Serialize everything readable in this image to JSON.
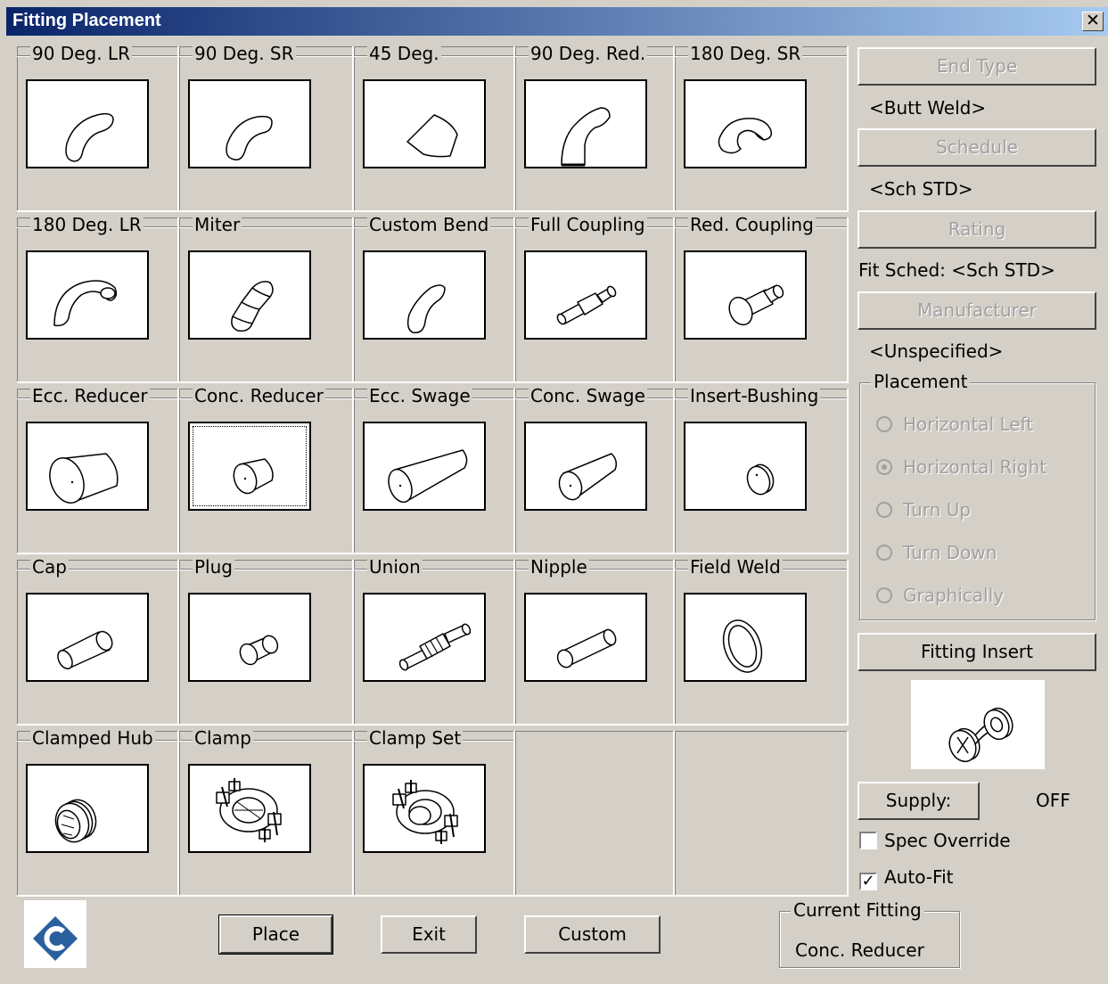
{
  "window": {
    "title": "Fitting Placement",
    "close_glyph": "✕"
  },
  "fittings": [
    {
      "label": "90 Deg. LR",
      "icon": "elbow-90-lr-icon"
    },
    {
      "label": "90 Deg. SR",
      "icon": "elbow-90-sr-icon"
    },
    {
      "label": "45 Deg.",
      "icon": "elbow-45-icon"
    },
    {
      "label": "90 Deg. Red.",
      "icon": "elbow-90-reducing-icon"
    },
    {
      "label": "180 Deg. SR",
      "icon": "return-180-sr-icon"
    },
    {
      "label": "180 Deg. LR",
      "icon": "return-180-lr-icon"
    },
    {
      "label": "Miter",
      "icon": "miter-icon"
    },
    {
      "label": "Custom Bend",
      "icon": "custom-bend-icon"
    },
    {
      "label": "Full Coupling",
      "icon": "full-coupling-icon"
    },
    {
      "label": "Red. Coupling",
      "icon": "reducing-coupling-icon"
    },
    {
      "label": "Ecc. Reducer",
      "icon": "ecc-reducer-icon"
    },
    {
      "label": "Conc. Reducer",
      "icon": "conc-reducer-icon"
    },
    {
      "label": "Ecc. Swage",
      "icon": "ecc-swage-icon"
    },
    {
      "label": "Conc. Swage",
      "icon": "conc-swage-icon"
    },
    {
      "label": "Insert-Bushing",
      "icon": "insert-bushing-icon"
    },
    {
      "label": "Cap",
      "icon": "cap-icon"
    },
    {
      "label": "Plug",
      "icon": "plug-icon"
    },
    {
      "label": "Union",
      "icon": "union-icon"
    },
    {
      "label": "Nipple",
      "icon": "nipple-icon"
    },
    {
      "label": "Field Weld",
      "icon": "field-weld-icon"
    },
    {
      "label": "Clamped Hub",
      "icon": "clamped-hub-icon"
    },
    {
      "label": "Clamp",
      "icon": "clamp-icon"
    },
    {
      "label": "Clamp Set",
      "icon": "clamp-set-icon"
    }
  ],
  "selected_fitting": "Conc. Reducer",
  "side": {
    "end_type_button": "End Type",
    "end_type_value": "<Butt Weld>",
    "schedule_button": "Schedule",
    "schedule_value": "<Sch STD>",
    "rating_button": "Rating",
    "fit_sched": "Fit Sched: <Sch STD>",
    "manufacturer_button": "Manufacturer",
    "manufacturer_value": "<Unspecified>",
    "placement_label": "Placement",
    "placement_options": [
      "Horizontal Left",
      "Horizontal Right",
      "Turn Up",
      "Turn Down",
      "Graphically"
    ],
    "placement_selected": "Horizontal Right",
    "fitting_insert_button": "Fitting Insert",
    "insert_preview_icon": "fitting-insert-preview-icon",
    "supply_button": "Supply:",
    "supply_value": "OFF",
    "spec_override_label": "Spec Override",
    "spec_override_checked": false,
    "auto_fit_label": "Auto-Fit",
    "auto_fit_checked": true
  },
  "footer": {
    "logo_icon": "app-logo-icon",
    "place_button": "Place",
    "exit_button": "Exit",
    "custom_button": "Custom",
    "current_fitting_label": "Current Fitting",
    "current_fitting_value": "Conc. Reducer"
  }
}
